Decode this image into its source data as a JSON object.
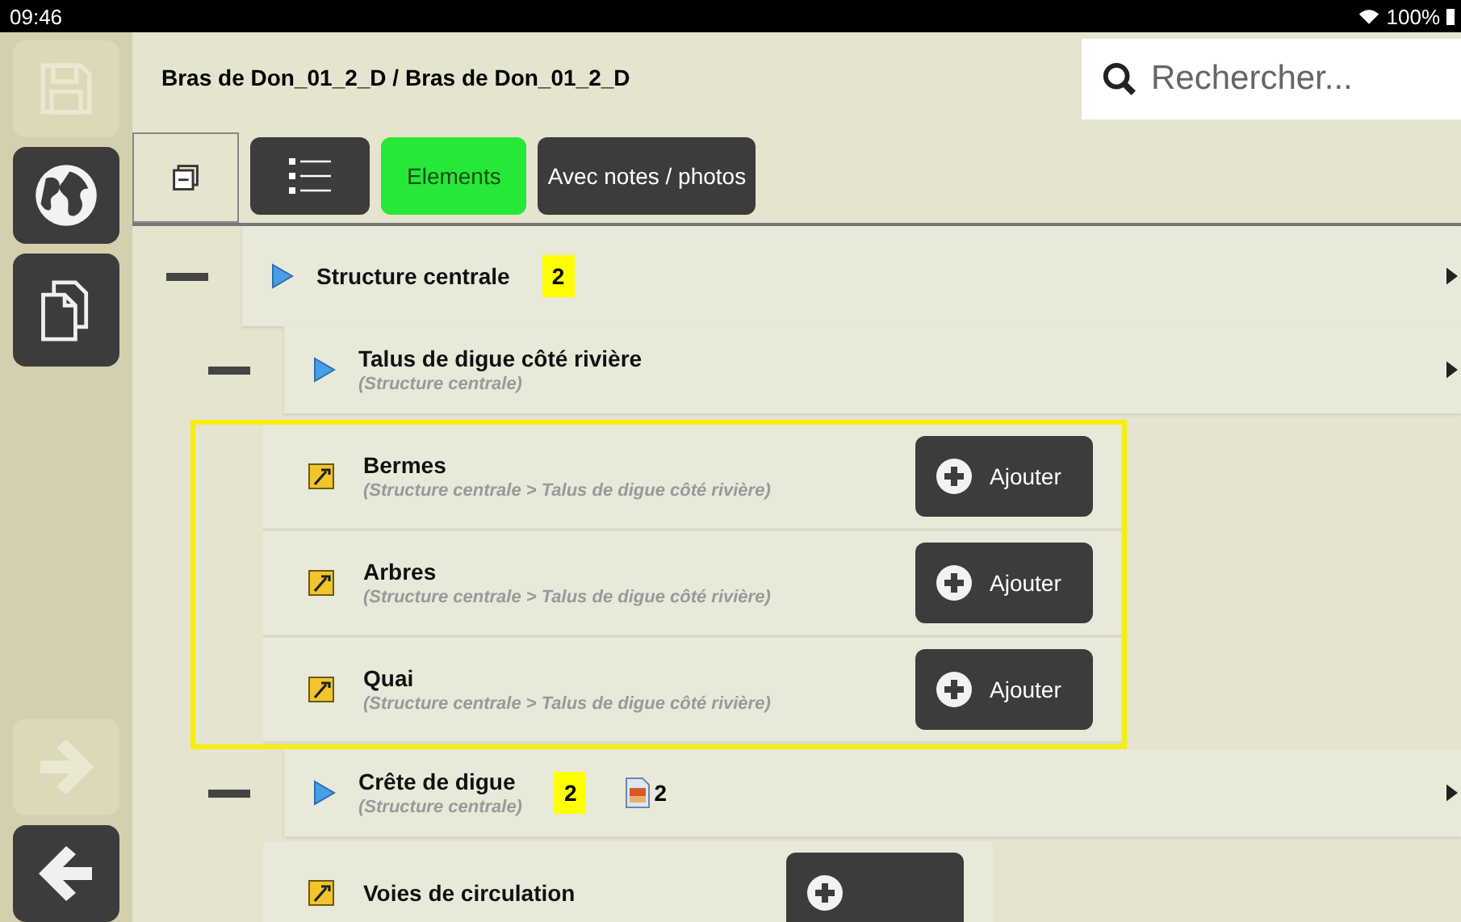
{
  "status_bar": {
    "time": "09:46",
    "battery": "100%"
  },
  "sidebar": [
    {
      "kind": "save",
      "disabled": true
    },
    {
      "kind": "globe",
      "disabled": false
    },
    {
      "kind": "copy",
      "disabled": false
    },
    {
      "kind": "spacer"
    },
    {
      "kind": "forward",
      "disabled": true
    },
    {
      "kind": "back",
      "disabled": false
    }
  ],
  "header": {
    "title": "Bras de Don_01_2_D / Bras de Don_01_2_D"
  },
  "search": {
    "placeholder": "Rechercher..."
  },
  "tabs": [
    {
      "kind": "collapse",
      "selected": false
    },
    {
      "kind": "list",
      "selected": false
    },
    {
      "kind": "text",
      "label": "Elements",
      "selected": true
    },
    {
      "kind": "text",
      "label": "Avec notes / photos",
      "selected": false
    }
  ],
  "tree": [
    {
      "label": "Structure centrale",
      "badge": "2",
      "expanded": true,
      "children": [
        {
          "label": "Talus de digue côté rivière",
          "subtitle": "(Structure centrale)",
          "expanded": true,
          "highlighted": true,
          "children": [
            {
              "label": "Bermes",
              "path": "(Structure centrale > Talus de digue côté rivière)",
              "button": "Ajouter"
            },
            {
              "label": "Arbres",
              "path": "(Structure centrale > Talus de digue côté rivière)",
              "button": "Ajouter"
            },
            {
              "label": "Quai",
              "path": "(Structure centrale > Talus de digue côté rivière)",
              "button": "Ajouter"
            }
          ]
        },
        {
          "label": "Crête de digue",
          "subtitle": "(Structure centrale)",
          "badge": "2",
          "photos": "2",
          "expanded": true,
          "highlighted": false,
          "children": [
            {
              "label": "Voies de circulation"
            }
          ]
        }
      ]
    }
  ]
}
